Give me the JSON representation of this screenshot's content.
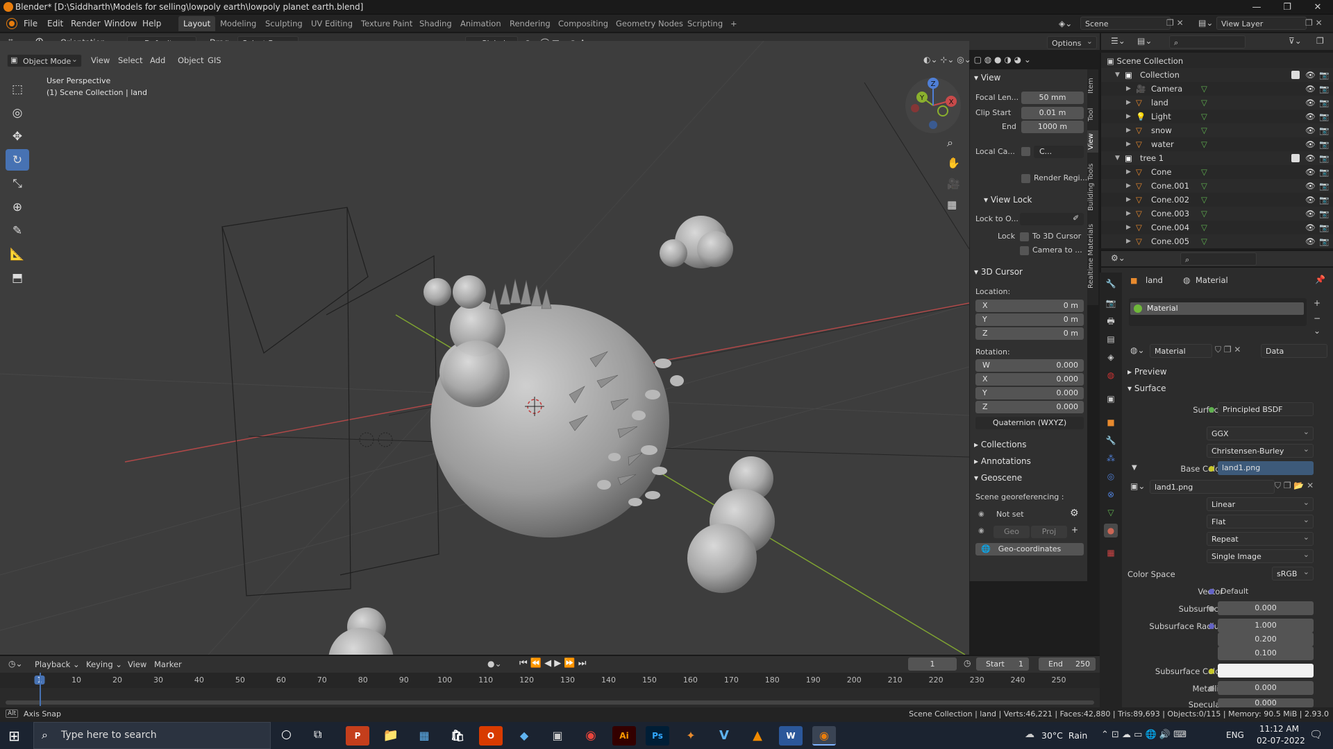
{
  "window": {
    "title": "Blender* [D:\\Siddharth\\Models for selling\\lowpoly earth\\lowpoly planet earth.blend]"
  },
  "menus": [
    "File",
    "Edit",
    "Render",
    "Window",
    "Help"
  ],
  "workspaces": [
    "Layout",
    "Modeling",
    "Sculpting",
    "UV Editing",
    "Texture Paint",
    "Shading",
    "Animation",
    "Rendering",
    "Compositing",
    "Geometry Nodes",
    "Scripting",
    "+"
  ],
  "scene": {
    "label": "Scene",
    "view_layer": "View Layer"
  },
  "tool_header": {
    "orientation_label": "Orientation:",
    "orientation": "Default",
    "drag_label": "Drag:",
    "drag": "Select Box",
    "transform": "Global",
    "options": "Options"
  },
  "viewport_header": {
    "mode": "Object Mode",
    "menus": [
      "View",
      "Select",
      "Add",
      "Object",
      "GIS"
    ]
  },
  "viewport": {
    "perspective": "User Perspective",
    "collection_info": "(1) Scene Collection | land"
  },
  "gizmo": {
    "x": "X",
    "y": "Y",
    "z": "Z"
  },
  "sidebar_tabs": [
    "Item",
    "Tool",
    "View",
    "Building Tools",
    "Realtime Materials"
  ],
  "npanel": {
    "view_title": "View",
    "focal_label": "Focal Len...",
    "focal": "50 mm",
    "clip_start_label": "Clip Start",
    "clip_start": "0.01 m",
    "clip_end_label": "End",
    "clip_end": "1000 m",
    "local_cam_label": "Local Ca...",
    "local_cam_value": "C...",
    "render_region": "Render Regi...",
    "view_lock_title": "View Lock",
    "lock_to_label": "Lock to O...",
    "lock_label": "Lock",
    "to_cursor": "To 3D Cursor",
    "camera_to": "Camera to ...",
    "cursor_title": "3D Cursor",
    "location_label": "Location:",
    "loc": [
      {
        "axis": "X",
        "value": "0 m"
      },
      {
        "axis": "Y",
        "value": "0 m"
      },
      {
        "axis": "Z",
        "value": "0 m"
      }
    ],
    "rotation_label": "Rotation:",
    "rot": [
      {
        "axis": "W",
        "value": "0.000"
      },
      {
        "axis": "X",
        "value": "0.000"
      },
      {
        "axis": "Y",
        "value": "0.000"
      },
      {
        "axis": "Z",
        "value": "0.000"
      }
    ],
    "rot_mode": "Quaternion (WXYZ)",
    "collections": "Collections",
    "annotations": "Annotations",
    "geoscene": "Geoscene",
    "georef_label": "Scene georeferencing :",
    "not_set": "Not set",
    "geo": "Geo",
    "proj": "Proj",
    "geo_coords": "Geo-coordinates"
  },
  "outliner": {
    "root": "Scene Collection",
    "items": [
      {
        "name": "Collection",
        "indent": 1,
        "type": "collection"
      },
      {
        "name": "Camera",
        "indent": 2,
        "type": "camera"
      },
      {
        "name": "land",
        "indent": 2,
        "type": "mesh"
      },
      {
        "name": "Light",
        "indent": 2,
        "type": "light"
      },
      {
        "name": "snow",
        "indent": 2,
        "type": "mesh"
      },
      {
        "name": "water",
        "indent": 2,
        "type": "mesh"
      },
      {
        "name": "tree 1",
        "indent": 1,
        "type": "collection"
      },
      {
        "name": "Cone",
        "indent": 2,
        "type": "mesh"
      },
      {
        "name": "Cone.001",
        "indent": 2,
        "type": "mesh"
      },
      {
        "name": "Cone.002",
        "indent": 2,
        "type": "mesh"
      },
      {
        "name": "Cone.003",
        "indent": 2,
        "type": "mesh"
      },
      {
        "name": "Cone.004",
        "indent": 2,
        "type": "mesh"
      },
      {
        "name": "Cone.005",
        "indent": 2,
        "type": "mesh"
      }
    ]
  },
  "properties": {
    "breadcrumb_object": "land",
    "breadcrumb_material": "Material",
    "slot": "Material",
    "material_name": "Material",
    "link": "Data",
    "preview": "Preview",
    "surface_section": "Surface",
    "surface_label": "Surface",
    "surface_value": "Principled BSDF",
    "distribution": "GGX",
    "subsurface_method": "Christensen-Burley",
    "base_color_label": "Base Color",
    "base_color_value": "land1.png",
    "image_name": "land1.png",
    "interpolation": "Linear",
    "projection": "Flat",
    "extension": "Repeat",
    "source": "Single Image",
    "color_space_label": "Color Space",
    "color_space": "sRGB",
    "vector_label": "Vector",
    "vector_value": "Default",
    "subsurface_label": "Subsurface",
    "subsurface_value": "0.000",
    "subsurface_radius_label": "Subsurface Radius",
    "radius": [
      "1.000",
      "0.200",
      "0.100"
    ],
    "subsurface_color_label": "Subsurface Color",
    "metallic_label": "Metallic",
    "metallic_value": "0.000",
    "specular_label": "Specular",
    "specular_value": "0.000"
  },
  "timeline": {
    "menus": [
      "Playback",
      "Keying",
      "View",
      "Marker"
    ],
    "current_frame": "1",
    "start_label": "Start",
    "start": "1",
    "end_label": "End",
    "end": "250",
    "ticks": [
      "1",
      "10",
      "20",
      "30",
      "40",
      "50",
      "60",
      "70",
      "80",
      "90",
      "100",
      "110",
      "120",
      "130",
      "140",
      "150",
      "160",
      "170",
      "180",
      "190",
      "200",
      "210",
      "220",
      "230",
      "240",
      "250"
    ]
  },
  "statusbar": {
    "left": "Axis Snap",
    "right": "Scene Collection | land | Verts:46,221 | Faces:42,880 | Tris:89,693 | Objects:0/115 | Memory: 90.5 MiB | 2.93.0"
  },
  "taskbar": {
    "search_placeholder": "Type here to search",
    "weather": "30°C  Rain",
    "lang": "ENG",
    "time": "11:12 AM",
    "date": "02-07-2022"
  },
  "colors": {
    "accent": "#4772b3",
    "x_axis": "#c84a4a",
    "y_axis": "#8ab02e",
    "z_axis": "#4f7fd6",
    "orange": "#e88a2e"
  }
}
